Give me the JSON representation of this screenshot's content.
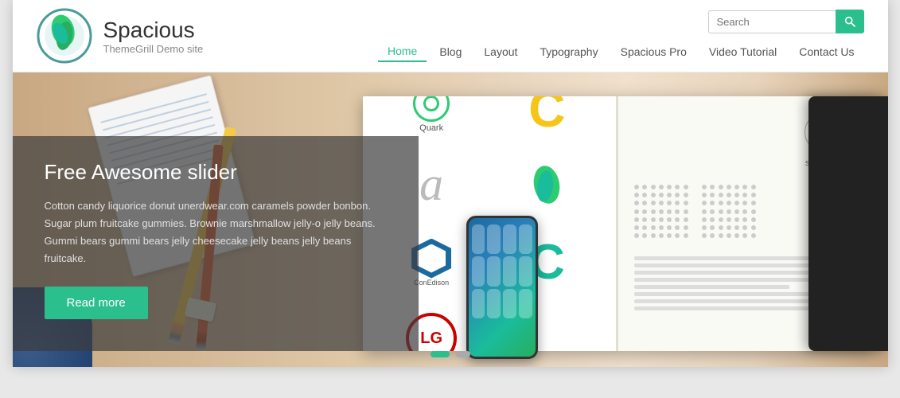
{
  "site": {
    "name": "Spacious",
    "tagline": "ThemeGrill Demo site",
    "logo_alt": "Spacious logo"
  },
  "header": {
    "search_placeholder": "Search",
    "search_button_label": "Search"
  },
  "nav": {
    "items": [
      {
        "label": "Home",
        "active": true
      },
      {
        "label": "Blog",
        "active": false
      },
      {
        "label": "Layout",
        "active": false
      },
      {
        "label": "Typography",
        "active": false
      },
      {
        "label": "Spacious Pro",
        "active": false
      },
      {
        "label": "Video Tutorial",
        "active": false
      },
      {
        "label": "Contact Us",
        "active": false
      }
    ]
  },
  "hero": {
    "title": "Free Awesome slider",
    "description": "Cotton candy liquorice donut unerdwear.com caramels powder bonbon. Sugar plum fruitcake gummies. Brownie marshmallow jelly-o jelly beans. Gummi bears gummi bears jelly cheesecake jelly beans jelly beans fruitcake.",
    "read_more_label": "Read more"
  },
  "slider": {
    "dots": [
      {
        "active": true
      },
      {
        "active": false
      }
    ]
  },
  "colors": {
    "accent": "#2bbf8e",
    "nav_active": "#2bbf8e"
  }
}
